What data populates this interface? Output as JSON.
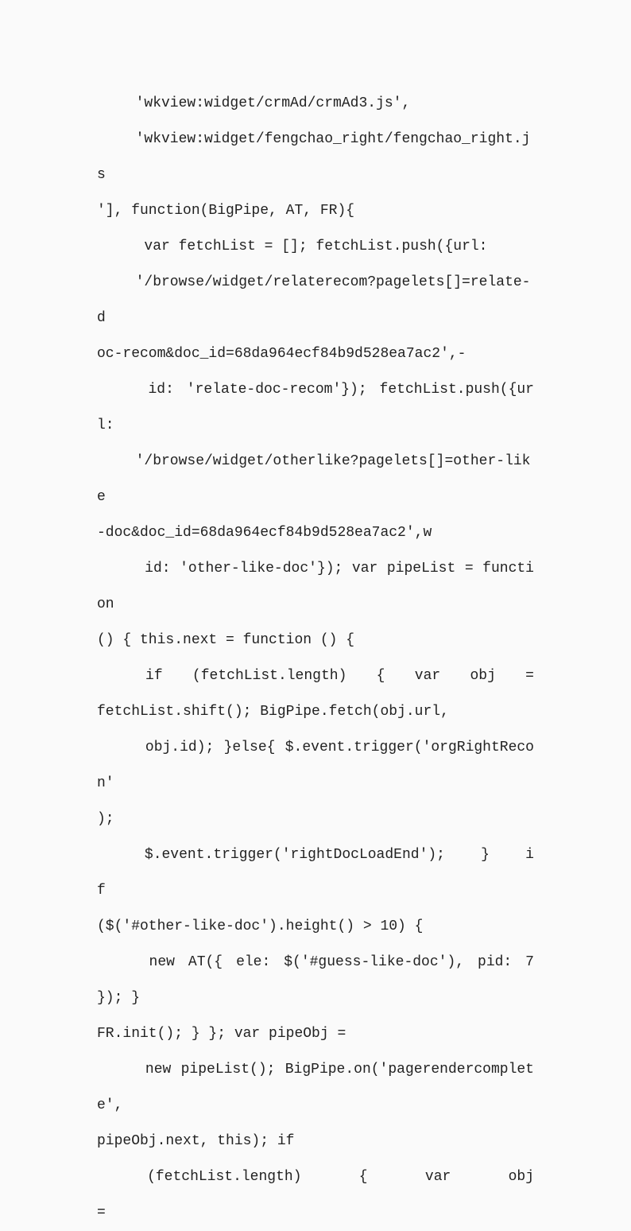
{
  "lines": [
    {
      "t": "'wkview:widget/crmAd/crmAd3.js',",
      "cls": "indent"
    },
    {
      "t": "'wkview:widget/fengchao_right/fengchao_right.js",
      "cls": "indent"
    },
    {
      "t": "'], function(BigPipe, AT, FR){",
      "cls": ""
    },
    {
      "t": " var fetchList = []; fetchList.push({url:",
      "cls": "indent"
    },
    {
      "t": "'/browse/widget/relaterecom?pagelets[]=relate-d",
      "cls": "indent"
    },
    {
      "t": "oc-recom&doc_id=68da964ecf84b9d528ea7ac2',-",
      "cls": ""
    },
    {
      "t": " id: 'relate-doc-recom'}); fetchList.push({url:",
      "cls": "indent"
    },
    {
      "t": "'/browse/widget/otherlike?pagelets[]=other-like",
      "cls": "indent"
    },
    {
      "t": "-doc&doc_id=68da964ecf84b9d528ea7ac2',w",
      "cls": ""
    },
    {
      "t": " id: 'other-like-doc'}); var pipeList = function",
      "cls": "indent"
    },
    {
      "t": "() { this.next = function () {",
      "cls": ""
    },
    {
      "t": " if   (fetchList.length)   {   var   obj   =",
      "cls": "indent just"
    },
    {
      "t": "fetchList.shift(); BigPipe.fetch(obj.url,",
      "cls": ""
    },
    {
      "t": " obj.id); }else{ $.event.trigger('orgRightRecon'",
      "cls": "indent"
    },
    {
      "t": ");",
      "cls": ""
    },
    {
      "t": " $.event.trigger('rightDocLoadEnd');    }    if",
      "cls": "indent just"
    },
    {
      "t": "($('#other-like-doc').height() > 10) {",
      "cls": ""
    },
    {
      "t": " new AT({ ele: $('#guess-like-doc'), pid: 7 }); }",
      "cls": "indent"
    },
    {
      "t": "FR.init(); } }; var pipeObj =",
      "cls": ""
    },
    {
      "t": " new pipeList(); BigPipe.on('pagerendercomplete',",
      "cls": "indent"
    },
    {
      "t": "pipeObj.next, this); if",
      "cls": ""
    },
    {
      "t": " (fetchList.length)     {     var     obj     =",
      "cls": "indent just"
    }
  ]
}
